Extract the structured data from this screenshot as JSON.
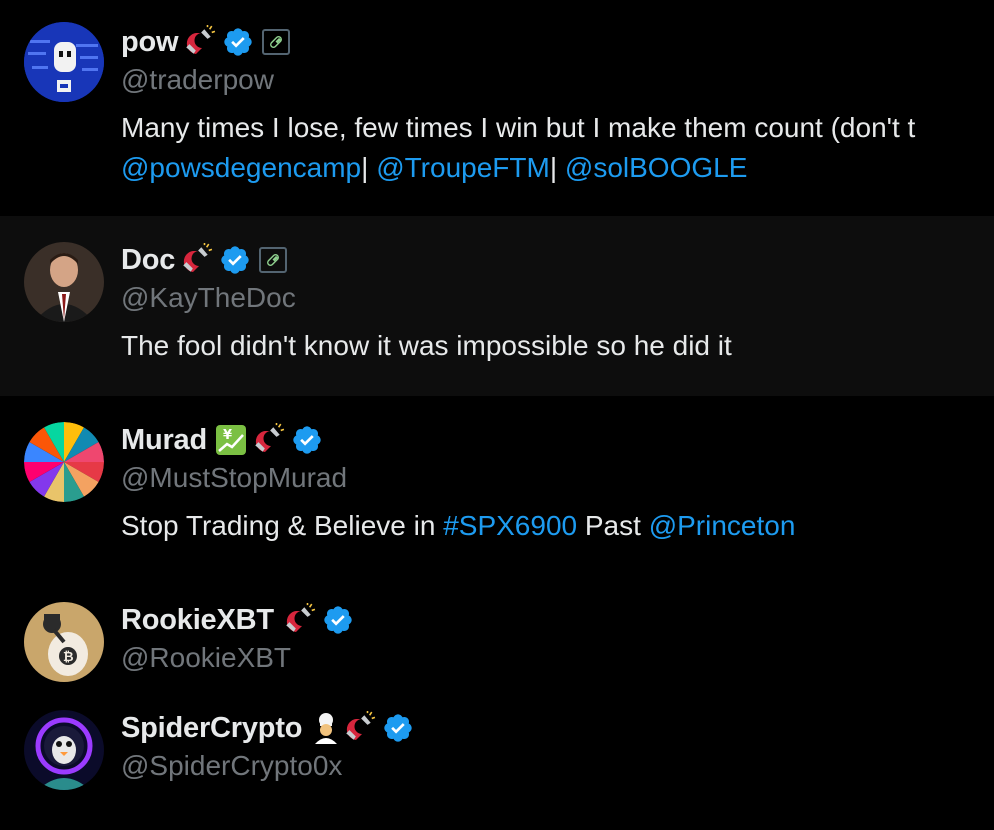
{
  "users": [
    {
      "name": "pow",
      "handle": "@traderpow",
      "badges": [
        "magnet-emoji",
        "verified-badge",
        "pill-affiliate-badge"
      ],
      "bio_text": "Many times I lose, few times I win but I make them count (don't t",
      "bio_links": [
        "@powsdegencamp",
        "@TroupeFTM",
        "@solBOOGLE"
      ],
      "bio_separator": "|"
    },
    {
      "name": "Doc",
      "handle": "@KayTheDoc",
      "badges": [
        "magnet-emoji",
        "verified-badge",
        "pill-affiliate-badge"
      ],
      "bio_text": "The fool didn't know it was impossible so he did it"
    },
    {
      "name": "Murad",
      "handle": "@MustStopMurad",
      "badges": [
        "yen-chart-emoji",
        "magnet-emoji",
        "verified-badge"
      ],
      "bio_prefix": "Stop Trading & Believe in ",
      "bio_hashtag": "#SPX6900",
      "bio_middle": " Past ",
      "bio_mention": "@Princeton"
    },
    {
      "name": "RookieXBT",
      "handle": "@RookieXBT",
      "badges": [
        "magnet-emoji",
        "verified-badge"
      ]
    },
    {
      "name": "SpiderCrypto",
      "handle": "@SpiderCrypto0x",
      "badges": [
        "chef-emoji",
        "magnet-emoji",
        "verified-badge"
      ]
    }
  ],
  "colors": {
    "background": "#000000",
    "highlight_row": "#0d0d0d",
    "text": "#e7e9ea",
    "muted": "#71767b",
    "link": "#1d9bf0",
    "verified": "#1d9bf0"
  }
}
